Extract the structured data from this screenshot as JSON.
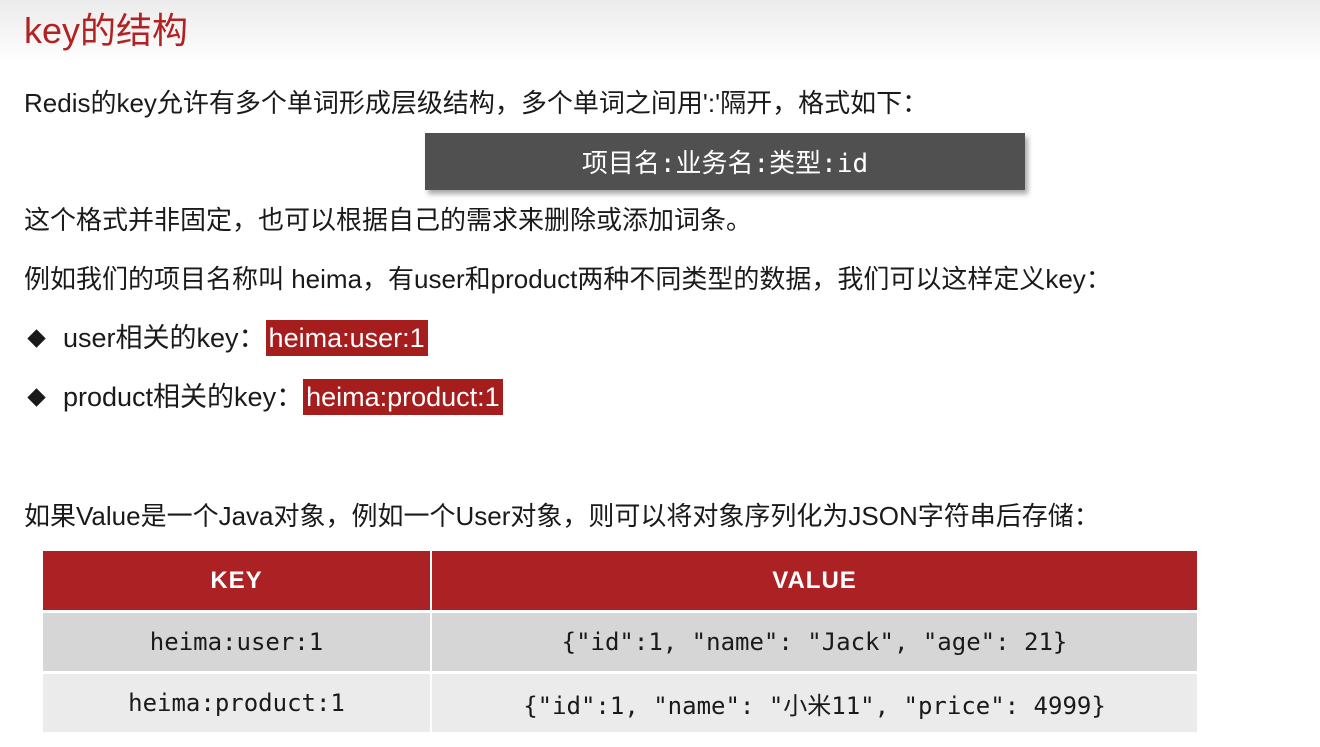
{
  "title": "key的结构",
  "intro": "Redis的key允许有多个单词形成层级结构，多个单词之间用':'隔开，格式如下：",
  "format_box": "项目名:业务名:类型:id",
  "note": "这个格式并非固定，也可以根据自己的需求来删除或添加词条。",
  "example_intro": "例如我们的项目名称叫 heima，有user和product两种不同类型的数据，我们可以这样定义key：",
  "bullets": [
    {
      "label": "user相关的key：",
      "key": "heima:user:1"
    },
    {
      "label": "product相关的key：",
      "key": "heima:product:1"
    }
  ],
  "json_intro": "如果Value是一个Java对象，例如一个User对象，则可以将对象序列化为JSON字符串后存储：",
  "table": {
    "headers": [
      "KEY",
      "VALUE"
    ],
    "rows": [
      [
        "heima:user:1",
        "{\"id\":1, \"name\": \"Jack\", \"age\": 21}"
      ],
      [
        "heima:product:1",
        "{\"id\":1, \"name\": \"小米11\", \"price\": 4999}"
      ]
    ]
  },
  "colors": {
    "accent": "#b22222",
    "header_bg": "#ac2123",
    "highlight_bg": "#a51d1d",
    "format_box_bg": "#505050",
    "row_odd": "#d6d6d6",
    "row_even": "#ebebeb"
  }
}
